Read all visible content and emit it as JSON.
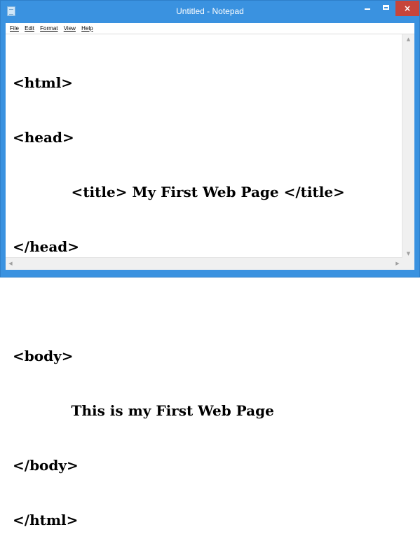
{
  "window": {
    "title": "Untitled - Notepad",
    "close_glyph": "×"
  },
  "menu": [
    "File",
    "Edit",
    "Format",
    "View",
    "Help"
  ],
  "editor": {
    "lines": [
      "<html>",
      "<head>",
      "            <title> My First Web Page </title>",
      "</head>",
      "",
      "<body>",
      "            This is my First Web Page",
      "</body>",
      "</html>"
    ]
  },
  "scrollbars": {
    "up": "▲",
    "down": "▼",
    "left": "◀",
    "right": "▶"
  },
  "colors": {
    "titlebar": "#3a92e0",
    "close_button": "#c7453b",
    "background": "#ffffff"
  }
}
